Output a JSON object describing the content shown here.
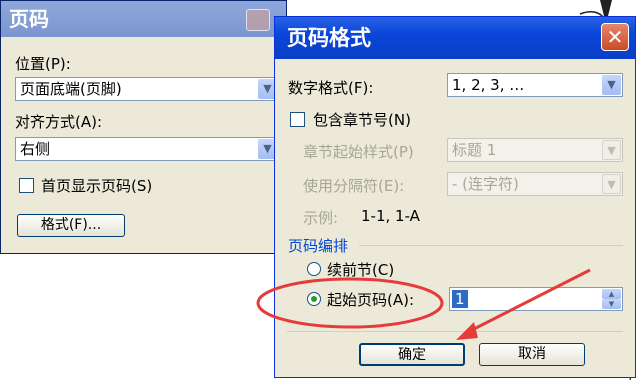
{
  "back_dialog": {
    "title": "页码",
    "position_label": "位置(P):",
    "position_value": "页面底端(页脚)",
    "alignment_label": "对齐方式(A):",
    "alignment_value": "右侧",
    "show_first_page_label": "首页显示页码(S)",
    "show_first_page_checked": false,
    "format_button": "格式(F)..."
  },
  "front_dialog": {
    "title": "页码格式",
    "close_symbol": "✕",
    "number_format_label": "数字格式(F):",
    "number_format_value": "1, 2, 3, …",
    "include_chapter_label": "包含章节号(N)",
    "include_chapter_checked": false,
    "chapter_style_label": "章节起始样式(P)",
    "chapter_style_value": "标题 1",
    "separator_label": "使用分隔符(E):",
    "separator_value": "-  (连字符)",
    "example_label": "示例:",
    "example_value": "1-1, 1-A",
    "numbering_group_title": "页码编排",
    "continue_label": "续前节(C)",
    "start_at_label": "起始页码(A):",
    "start_at_value": "1",
    "selected_option": "start_at",
    "ok_button": "确定",
    "cancel_button": "取消"
  },
  "colors": {
    "title_blue": "#0a46d8",
    "dialog_bg": "#ece9d8",
    "group_title": "#0046d5",
    "annotation_red": "#e53b3b"
  }
}
